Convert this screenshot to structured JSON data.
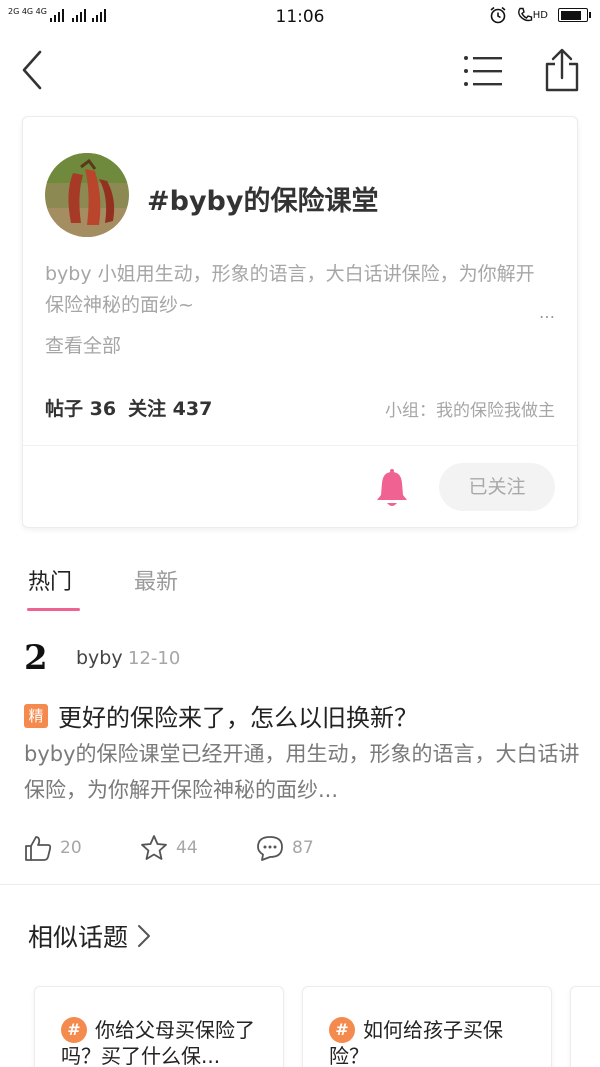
{
  "status_bar": {
    "network_label": "2G 4G 4G",
    "time": "11:06",
    "hd_label": "HD",
    "battery_level": 0.8
  },
  "header": {
    "back_icon": "chevron-left-icon",
    "menu_icon": "list-icon",
    "share_icon": "share-icon"
  },
  "topic": {
    "title": "#byby的保险课堂",
    "description": "byby 小姐用生动，形象的语言，大白话讲保险，为你解开保险神秘的面纱~",
    "more_glyph": "…",
    "view_all": "查看全部",
    "posts_stat": "帖子 36",
    "followers_stat": "关注 437",
    "group": "小组：我的保险我做主",
    "follow_label": "已关注",
    "bell_color": "#f06292"
  },
  "tabs": [
    {
      "label": "热门",
      "active": true
    },
    {
      "label": "最新",
      "active": false
    }
  ],
  "post": {
    "avatar_glyph": "2",
    "author": "byby",
    "date": "12-10",
    "badge": "精",
    "title": "更好的保险来了，怎么以旧换新？",
    "body": "byby的保险课堂已经开通，用生动，形象的语言，大白话讲保险，为你解开保险神秘的面纱...",
    "likes": "20",
    "favorites": "44",
    "comments": "87"
  },
  "similar": {
    "title": "相似话题",
    "items": [
      {
        "hash": "#",
        "text": "你给父母买保险了吗？买了什么保..."
      },
      {
        "hash": "#",
        "text": "如何给孩子买保险？"
      }
    ]
  },
  "colors": {
    "accent_pink": "#f06292",
    "badge_orange": "#f58a4e"
  }
}
